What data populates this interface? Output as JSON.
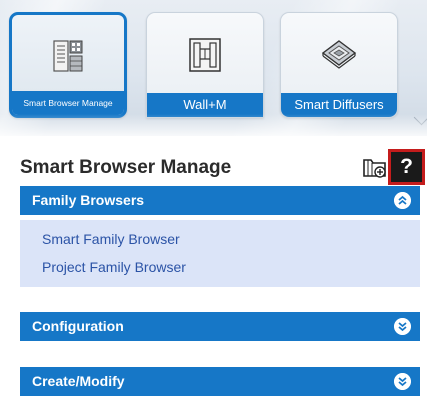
{
  "ribbon": {
    "tiles": [
      {
        "label": "Smart Browser Manage",
        "icon": "browser-manager-icon",
        "selected": true
      },
      {
        "label": "Wall+M",
        "icon": "wall-frame-icon",
        "selected": false
      },
      {
        "label": "Smart Diffusers",
        "icon": "diffuser-icon",
        "selected": false
      }
    ],
    "expand_icon": "chevron-down-icon"
  },
  "panel": {
    "title": "Smart Browser Manage",
    "browser_icon": "folder-add-icon",
    "help_label": "?",
    "sections": [
      {
        "title": "Family Browsers",
        "expanded": true,
        "items": [
          "Smart Family Browser",
          "Project Family Browser"
        ]
      },
      {
        "title": "Configuration",
        "expanded": false
      },
      {
        "title": "Create/Modify",
        "expanded": false
      }
    ]
  },
  "colors": {
    "accent": "#1677c7",
    "section_body": "#dbe4f8",
    "link": "#2b53a6",
    "highlight": "#c41c1c"
  }
}
